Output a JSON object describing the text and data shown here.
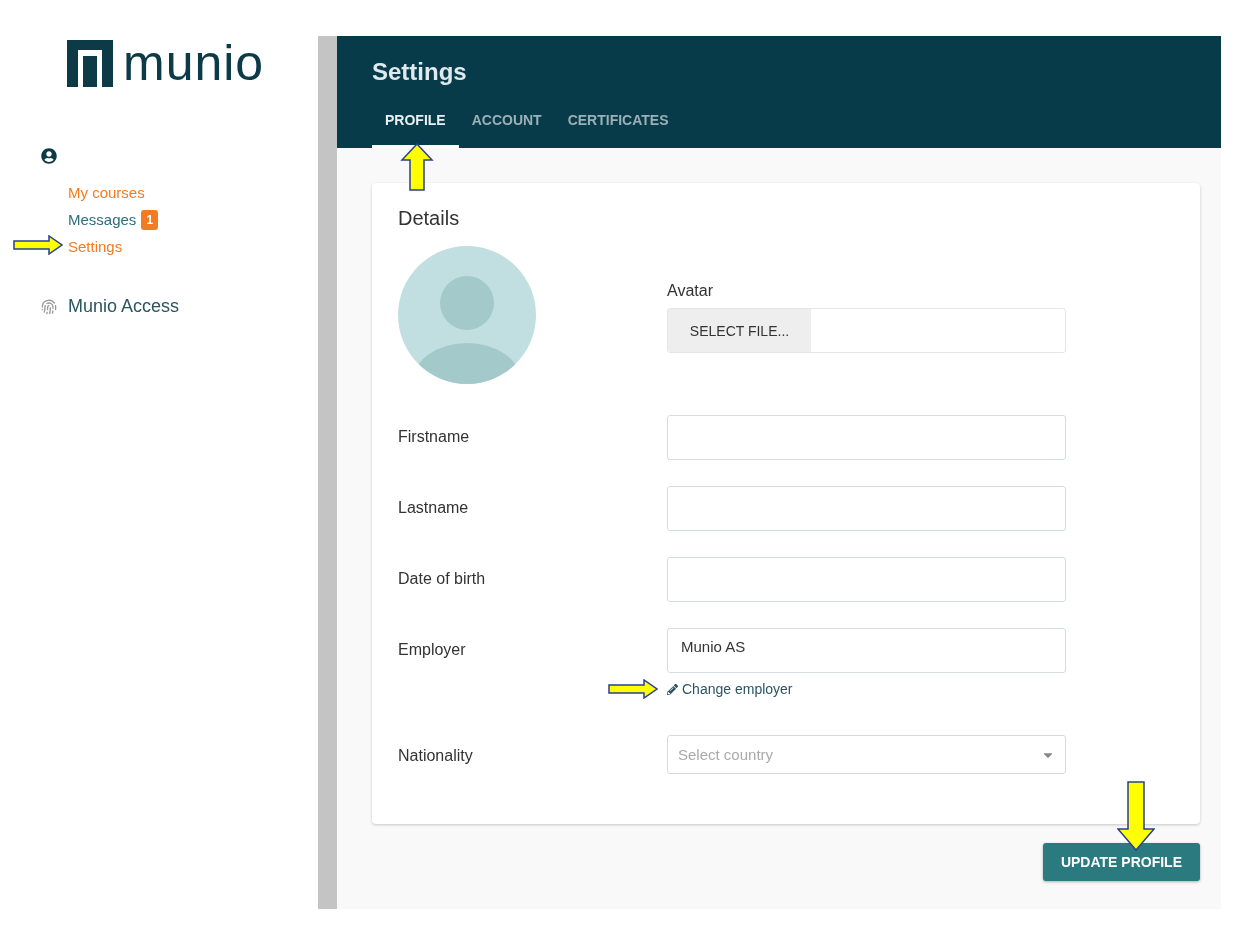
{
  "logo": {
    "text": "munio"
  },
  "sidebar": {
    "items": [
      {
        "label": "My courses",
        "highlighted": true
      },
      {
        "label": "Messages",
        "highlighted": false,
        "badge": "1"
      },
      {
        "label": "Settings",
        "highlighted": true
      }
    ],
    "app_link": "Munio Access"
  },
  "header": {
    "title": "Settings",
    "tabs": [
      {
        "label": "PROFILE",
        "selected": true
      },
      {
        "label": "ACCOUNT",
        "selected": false
      },
      {
        "label": "CERTIFICATES",
        "selected": false
      }
    ]
  },
  "card": {
    "title": "Details",
    "avatar": {
      "label": "Avatar",
      "button": "SELECT FILE..."
    },
    "fields": [
      {
        "kind": "text",
        "label": "Firstname"
      },
      {
        "kind": "text",
        "label": "Lastname"
      },
      {
        "kind": "text",
        "label": "Date of birth"
      },
      {
        "kind": "text",
        "label": "Employer",
        "value": "Munio AS",
        "link": "Change employer"
      },
      {
        "kind": "select",
        "label": "Nationality",
        "placeholder": "Select country"
      }
    ]
  },
  "submit": "UPDATE PROFILE"
}
